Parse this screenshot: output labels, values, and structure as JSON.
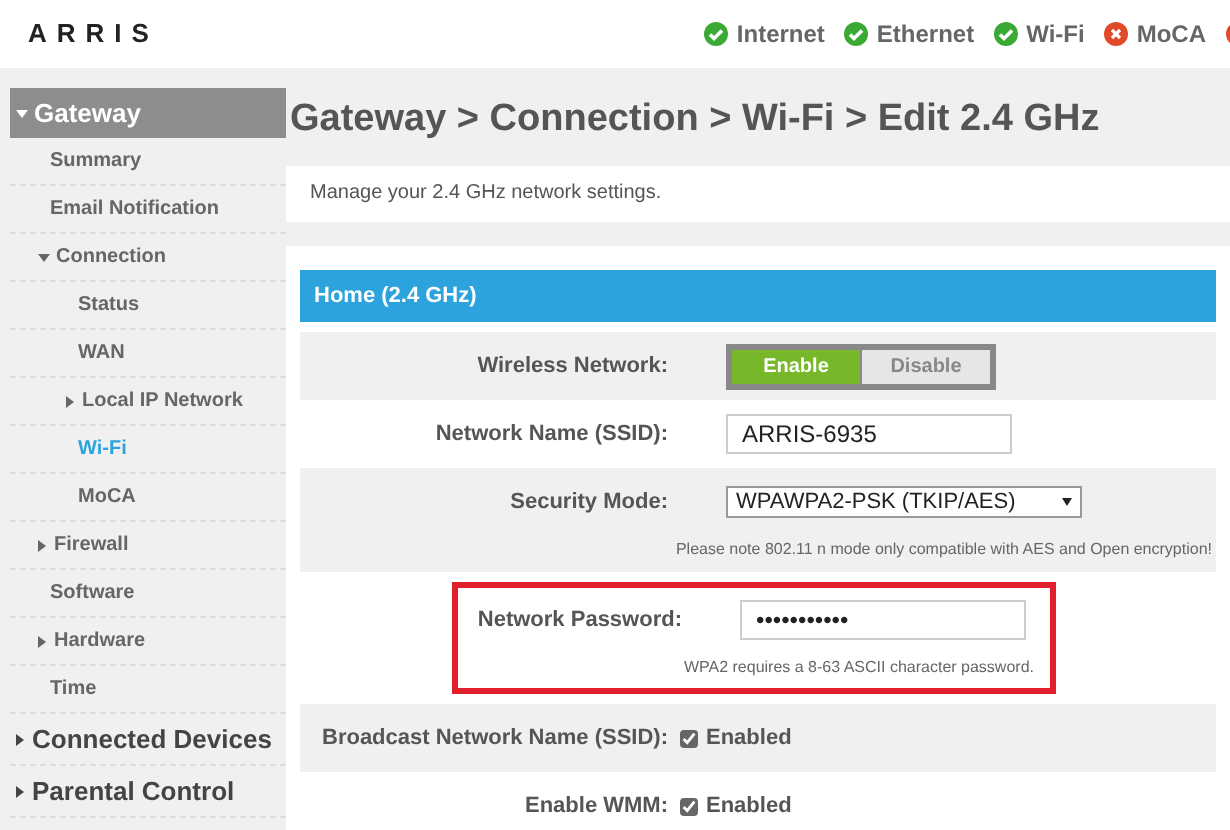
{
  "header": {
    "logo": "ARRIS",
    "status": [
      {
        "label": "Internet",
        "ok": true
      },
      {
        "label": "Ethernet",
        "ok": true
      },
      {
        "label": "Wi-Fi",
        "ok": true
      },
      {
        "label": "MoCA",
        "ok": false
      },
      {
        "ok": false
      }
    ]
  },
  "sidebar": {
    "items": [
      {
        "label": "Gateway",
        "expanded": true,
        "selected": false,
        "children": [
          {
            "label": "Summary",
            "selected": false
          },
          {
            "label": "Email Notification",
            "selected": false
          },
          {
            "label": "Connection",
            "expanded": true,
            "selected": false,
            "children": [
              {
                "label": "Status",
                "selected": false
              },
              {
                "label": "WAN",
                "selected": false
              },
              {
                "label": "Local IP Network",
                "expanded": false,
                "selected": false
              },
              {
                "label": "Wi-Fi",
                "selected": true
              },
              {
                "label": "MoCA",
                "selected": false
              }
            ]
          },
          {
            "label": "Firewall",
            "expanded": false,
            "selected": false
          },
          {
            "label": "Software",
            "selected": false
          },
          {
            "label": "Hardware",
            "expanded": false,
            "selected": false
          },
          {
            "label": "Time",
            "selected": false
          }
        ]
      },
      {
        "label": "Connected Devices",
        "expanded": false,
        "selected": false
      },
      {
        "label": "Parental Control",
        "expanded": false,
        "selected": false
      }
    ]
  },
  "page": {
    "title": "Gateway > Connection > Wi-Fi > Edit 2.4 GHz",
    "description": "Manage your 2.4 GHz network settings.",
    "section": "Home (2.4 GHz)",
    "rows": [
      {
        "kind": "toggle",
        "label": "Wireless Network:",
        "options": [
          {
            "label": "Enable",
            "selected": true
          },
          {
            "label": "Disable",
            "selected": false
          }
        ]
      },
      {
        "kind": "text",
        "label": "Network Name (SSID):",
        "value": "ARRIS-6935"
      },
      {
        "kind": "select",
        "label": "Security Mode:",
        "value": "WPAWPA2-PSK (TKIP/AES)",
        "note": "Please note 802.11 n mode only compatible with AES and Open encryption!"
      },
      {
        "kind": "password",
        "label": "Network Password:",
        "value": "•••••••••••",
        "note": "WPA2 requires a 8-63 ASCII character password.",
        "highlighted": true
      },
      {
        "kind": "checkbox",
        "label": "Broadcast Network Name (SSID):",
        "text": "Enabled",
        "checked": true
      },
      {
        "kind": "checkbox",
        "label": "Enable WMM:",
        "text": "Enabled",
        "checked": true
      }
    ]
  }
}
